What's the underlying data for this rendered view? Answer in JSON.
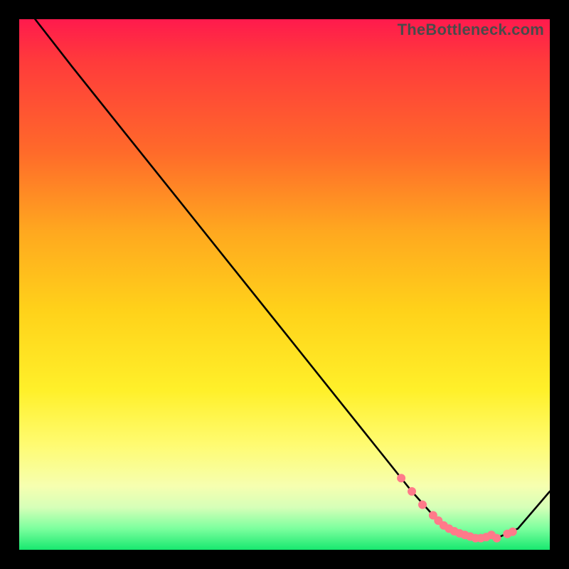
{
  "watermark": "TheBottleneck.com",
  "chart_data": {
    "type": "line",
    "title": "",
    "xlabel": "",
    "ylabel": "",
    "xlim": [
      0,
      100
    ],
    "ylim": [
      0,
      100
    ],
    "grid": false,
    "legend": false,
    "series": [
      {
        "name": "curve",
        "color": "#000000",
        "x": [
          3,
          10,
          20,
          30,
          40,
          50,
          60,
          68,
          74,
          78,
          82,
          86,
          90,
          94,
          100
        ],
        "y": [
          100,
          91,
          78.5,
          66,
          53.5,
          41,
          28.5,
          18.5,
          11,
          6.5,
          3.5,
          2.2,
          2.2,
          4.0,
          11
        ]
      }
    ],
    "markers": {
      "name": "valley-dots",
      "color": "#ff7a8a",
      "x": [
        72,
        74,
        76,
        78,
        79,
        80,
        81,
        82,
        83,
        84,
        85,
        86,
        87,
        88,
        89,
        90,
        92,
        93
      ],
      "y": [
        13.5,
        11,
        8.5,
        6.5,
        5.5,
        4.6,
        4.0,
        3.5,
        3.1,
        2.8,
        2.5,
        2.2,
        2.2,
        2.4,
        2.8,
        2.2,
        3.0,
        3.4
      ]
    }
  }
}
